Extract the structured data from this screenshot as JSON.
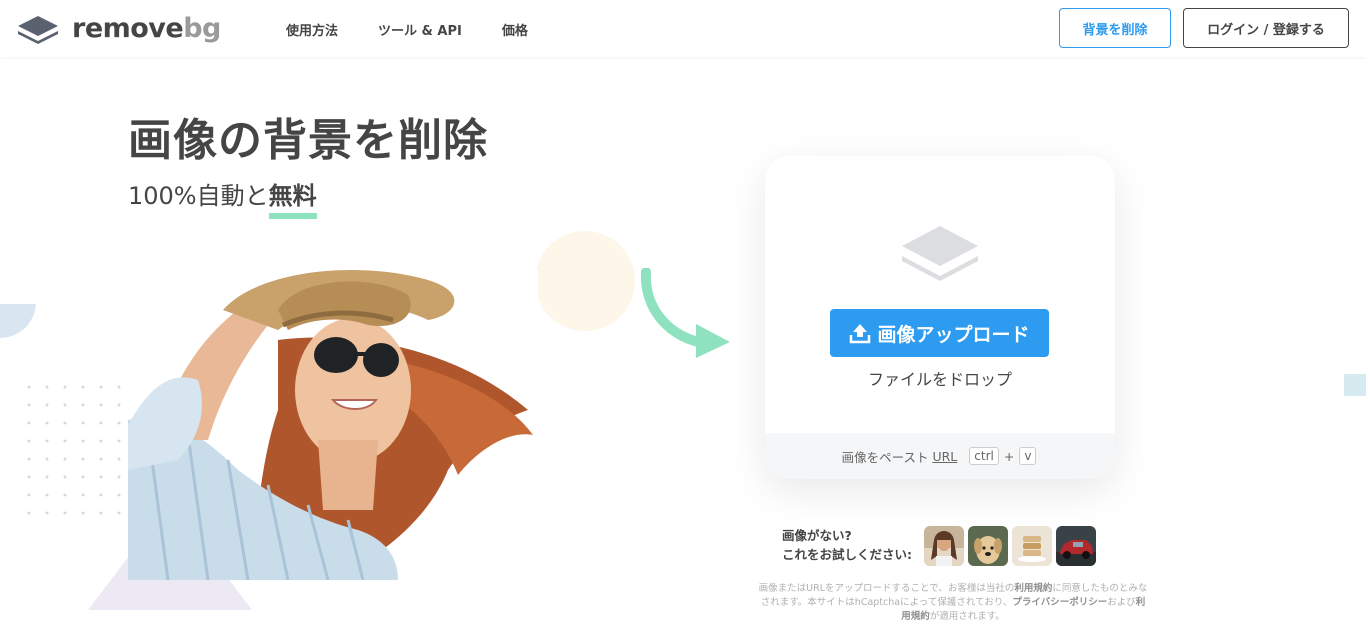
{
  "header": {
    "logo_main": "remove",
    "logo_accent": "bg",
    "nav": [
      "使用方法",
      "ツール & API",
      "価格"
    ],
    "remove_bg_button": "背景を削除",
    "login_button": "ログイン / 登録する"
  },
  "hero": {
    "title": "画像の背景を削除",
    "subtitle_prefix": "100%自動と",
    "subtitle_free": "無料"
  },
  "upload_card": {
    "upload_button": "画像アップロード",
    "drop_text": "ファイルをドロップ",
    "paste_label": "画像をペースト",
    "url_link": "URL",
    "key_ctrl": "ctrl",
    "key_plus": "+",
    "key_v": "v"
  },
  "samples": {
    "line1": "画像がない?",
    "line2": "これをお試しください:",
    "thumbnails": [
      "woman-sample",
      "dog-sample",
      "food-sample",
      "car-sample"
    ]
  },
  "legal": {
    "part1": "画像またはURLをアップロードすることで、お客様は当社の",
    "terms1": "利用規約",
    "part2": "に同意したものとみなされます。本サイトはhCaptchaによって保護されており、",
    "privacy": "プライバシーポリシー",
    "part3": "および",
    "terms2": "利用規約",
    "part4": "が適用されます。"
  },
  "colors": {
    "accent_blue": "#2d9bef",
    "highlight_green": "#8ee2c0",
    "text_dark": "#454545"
  }
}
